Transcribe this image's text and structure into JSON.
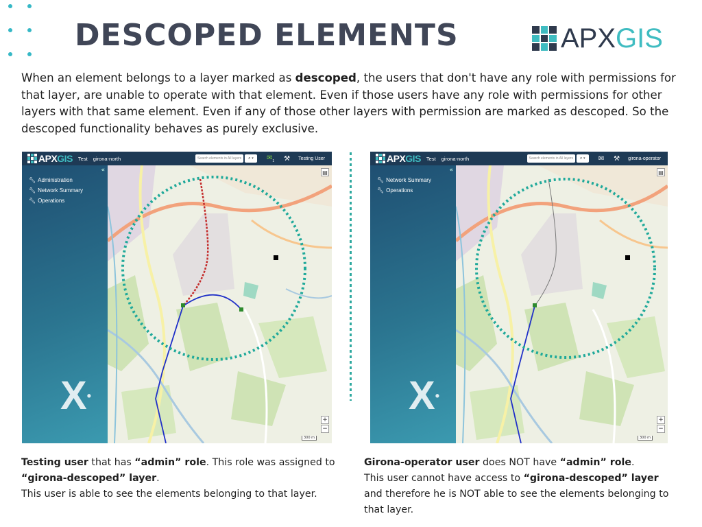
{
  "slide": {
    "title": "DESCOPED ELEMENTS",
    "brand_part1": "APX",
    "brand_part2": "GIS",
    "intro_before": "When an element belongs to a layer marked as ",
    "intro_bold": "descoped",
    "intro_after": ", the users that don't have any role with permissions for that layer, are unable to operate with that element. Even if those users have any role with permissions for other layers with that same element. Even if any of those other layers with permission are marked as descoped. So the descoped functionality behaves as purely exclusive.",
    "colors": {
      "title": "#404657",
      "accent": "#36b8c6",
      "brand_dark": "#2f3a4d",
      "circle": "#1fa99a"
    }
  },
  "left_shot": {
    "brand_part1": "APX",
    "brand_part2": "GIS",
    "env": "Test",
    "workspace": "girona-north",
    "search_placeholder": "Search elements in All layers",
    "search_icon": "search-icon",
    "dropdown_icon": "chevron-down-icon",
    "mail_badge": "1",
    "user": "Testing User",
    "collapse": "«",
    "menu": [
      {
        "label": "Administration",
        "icon": "wrench-icon"
      },
      {
        "label": "Network Summary",
        "icon": "wrench-icon"
      },
      {
        "label": "Operations",
        "icon": "wrench-icon"
      }
    ],
    "x_mark": "X",
    "zoom_in": "+",
    "zoom_out": "−",
    "scale": "300 m",
    "shows_descoped_element": true
  },
  "right_shot": {
    "brand_part1": "APX",
    "brand_part2": "GIS",
    "env": "Test",
    "workspace": "girona-north",
    "search_placeholder": "Search elements in All layers",
    "search_icon": "search-icon",
    "dropdown_icon": "chevron-down-icon",
    "user": "girona-operator",
    "collapse": "«",
    "menu": [
      {
        "label": "Network Summary",
        "icon": "wrench-icon"
      },
      {
        "label": "Operations",
        "icon": "wrench-icon"
      }
    ],
    "x_mark": "X",
    "zoom_in": "+",
    "zoom_out": "−",
    "scale": "300 m",
    "shows_descoped_element": false
  },
  "captions": {
    "left": {
      "b1": "Testing user",
      "t1": " that has ",
      "b2": "“admin” role",
      "t2": ". This role was assigned to ",
      "b3": "“girona-descoped” layer",
      "t3": ".",
      "line2": "This user is able to see the elements belonging to that layer."
    },
    "right": {
      "b1": "Girona-operator user",
      "t1": " does NOT have ",
      "b2": "“admin” role",
      "t2": ".",
      "t3": "This user cannot have access to ",
      "b3": "“girona-descoped” layer",
      "t4": " and therefore he is NOT able to see the elements belonging to that layer."
    }
  }
}
